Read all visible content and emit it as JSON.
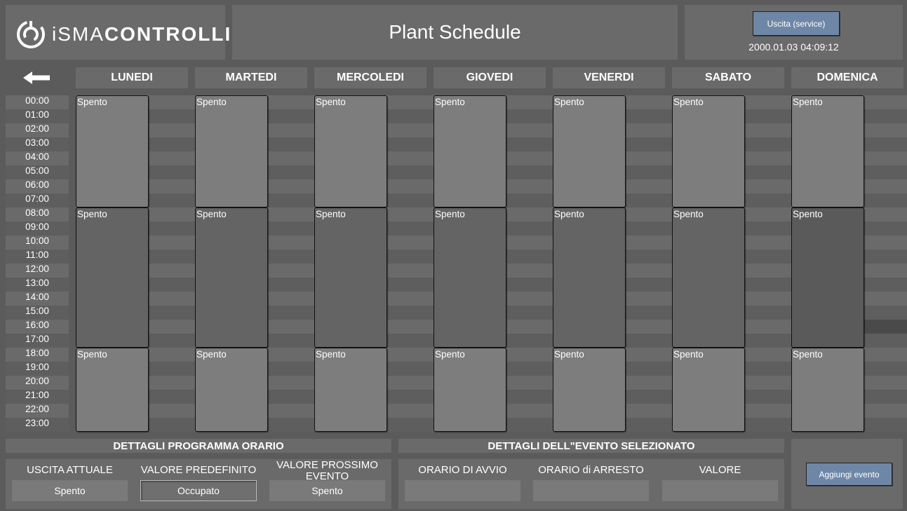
{
  "header": {
    "logo_text": "iSMACONTROLLI",
    "title": "Plant Schedule",
    "exit_button": "Uscita (service)",
    "datetime": "2000.01.03 04:09:12"
  },
  "nav": {
    "back_icon": "arrow-left-icon"
  },
  "days": [
    {
      "name": "LUNEDI",
      "events": [
        "Spento",
        "Spento",
        "Spento"
      ]
    },
    {
      "name": "MARTEDI",
      "events": [
        "Spento",
        "Spento",
        "Spento"
      ]
    },
    {
      "name": "MERCOLEDI",
      "events": [
        "Spento",
        "Spento",
        "Spento"
      ]
    },
    {
      "name": "GIOVEDI",
      "events": [
        "Spento",
        "Spento",
        "Spento"
      ]
    },
    {
      "name": "VENERDI",
      "events": [
        "Spento",
        "Spento",
        "Spento"
      ]
    },
    {
      "name": "SABATO",
      "events": [
        "Spento",
        "Spento",
        "Spento"
      ]
    },
    {
      "name": "DOMENICA",
      "events": [
        "Spento",
        "Spento",
        "Spento"
      ]
    }
  ],
  "hours": [
    "00:00",
    "01:00",
    "02:00",
    "03:00",
    "04:00",
    "05:00",
    "06:00",
    "07:00",
    "08:00",
    "09:00",
    "10:00",
    "11:00",
    "12:00",
    "13:00",
    "14:00",
    "15:00",
    "16:00",
    "17:00",
    "18:00",
    "19:00",
    "20:00",
    "21:00",
    "22:00",
    "23:00"
  ],
  "program_details": {
    "title": "DETTAGLI PROGRAMMA ORARIO",
    "current_output_label": "USCITA ATTUALE",
    "current_output_value": "Spento",
    "default_value_label": "VALORE PREDEFINITO",
    "default_value": "Occupato",
    "next_event_label": "VALORE PROSSIMO EVENTO",
    "next_event_value": "Spento"
  },
  "event_details": {
    "title": "DETTAGLI DELL\"EVENTO SELEZIONATO",
    "start_label": "ORARIO DI AVVIO",
    "start_value": "",
    "stop_label": "ORARIO di ARRESTO",
    "stop_value": "",
    "value_label": "VALORE",
    "value": ""
  },
  "add_event_button": "Aggiungi evento",
  "colors": {
    "background": "#5b5b5b",
    "panel": "#6a6a6a",
    "button": "#6e87a7",
    "event_light": "#7d7d7d",
    "event_dark": "#646464"
  }
}
